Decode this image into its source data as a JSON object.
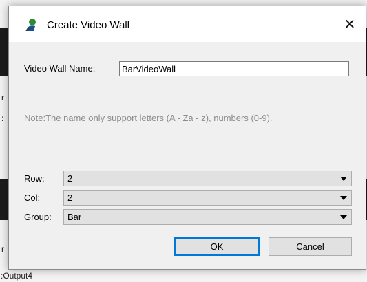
{
  "dialog": {
    "title": "Create Video Wall",
    "close_glyph": "✕",
    "title_icon": "person-icon",
    "name_label": "Video Wall Name:",
    "name_value": "BarVideoWall",
    "note": "Note:The name only support letters (A - Za - z), numbers (0-9).",
    "row_label": "Row:",
    "row_value": "2",
    "col_label": "Col:",
    "col_value": "2",
    "group_label": "Group:",
    "group_value": "Bar",
    "ok_label": "OK",
    "cancel_label": "Cancel"
  },
  "background": {
    "bottom_label": ":Output4",
    "edge_chars": [
      ":",
      ":",
      "r",
      "r"
    ]
  },
  "colors": {
    "accent": "#0078d7",
    "note_text": "#8c8c8c"
  }
}
